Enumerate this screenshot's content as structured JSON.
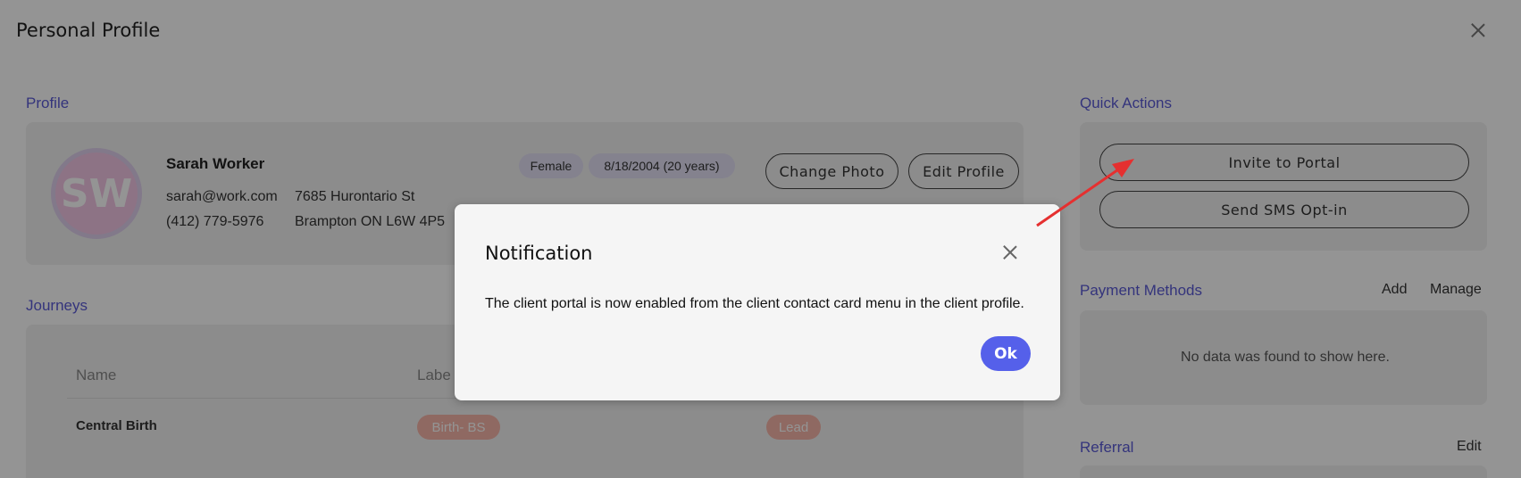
{
  "page": {
    "title": "Personal Profile"
  },
  "profile": {
    "section_label": "Profile",
    "avatar_initials": "SW",
    "name": "Sarah Worker",
    "email": "sarah@work.com",
    "phone": "(412) 779-5976",
    "address_line1": "7685 Hurontario St",
    "address_line2": "Brampton ON L6W 4P5",
    "gender": "Female",
    "dob": "8/18/2004 (20 years)",
    "change_photo_label": "Change Photo",
    "edit_profile_label": "Edit Profile"
  },
  "journeys": {
    "section_label": "Journeys",
    "columns": [
      "Name",
      "Labe"
    ],
    "rows": [
      {
        "name": "Central Birth",
        "label": "Birth- BS",
        "stage": "Lead"
      }
    ]
  },
  "quick_actions": {
    "section_label": "Quick Actions",
    "invite_label": "Invite to Portal",
    "sms_label": "Send SMS Opt-in"
  },
  "payment_methods": {
    "section_label": "Payment Methods",
    "add_label": "Add",
    "manage_label": "Manage",
    "empty_text": "No data was found to show here."
  },
  "referral": {
    "section_label": "Referral",
    "edit_label": "Edit"
  },
  "modal": {
    "title": "Notification",
    "message": "The client portal is now enabled from the client contact card menu in the client profile.",
    "ok_label": "Ok"
  },
  "colors": {
    "accent": "#5b5bd6",
    "button_primary": "#5560ea",
    "tag": "#f7b6a9",
    "annotation_arrow": "#e53030"
  }
}
